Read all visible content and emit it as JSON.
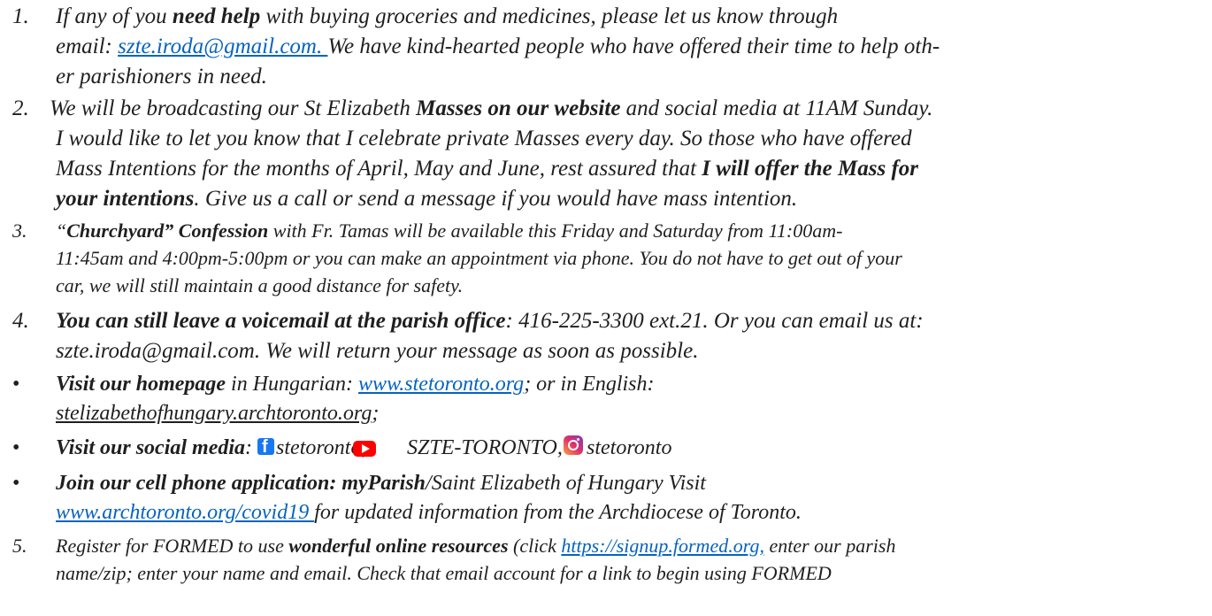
{
  "items": [
    {
      "num": "1.",
      "l1_bold": "need help",
      "l1_a": "If any of you ",
      "l1_b": " with buying groceries and  medicines, please let us know through",
      "l2_a": "email: ",
      "l2_link": "szte.iroda@gmail.com. ",
      "l2_b": "We have kind-hearted people who have offered their time to help oth-",
      "l3": "er parishioners in need."
    },
    {
      "num": "2.",
      "l1_a": " We will be broadcasting our St Elizabeth ",
      "l1_bold": "Masses on our website",
      "l1_b": " and social media at 11AM Sunday.",
      "l2": "I would like to let you know that I celebrate private Masses every day. So those who have offered",
      "l3_a": "Mass Intentions for the months of April, May and June, rest assured that ",
      "l3_bold": "I will offer the Mass for",
      "l4_bold": "your intentions",
      "l4_b": ". Give us a call or send a message if you would have mass intention."
    },
    {
      "num": "3.",
      "l1_a": "“",
      "l1_bold": "Churchyard” Confession",
      "l1_b": " with Fr. Tamas will be available this Friday and Saturday from 11:00am-",
      "l2": "11:45am and 4:00pm-5:00pm or you can make an appointment via phone. You do not have to get out of your",
      "l3": "car, we will still maintain a good distance for safety."
    },
    {
      "num": "4.",
      "l1_bold": "You can still leave a voicemail at the parish office",
      "l1_b": ": 416-225-3300 ext.21. Or you can email us at:",
      "l2": "szte.iroda@gmail.com. We will return your message as soon as possible."
    },
    {
      "bullet": "•",
      "l1_bold": "Visit our homepage",
      "l1_b": " in Hungarian: ",
      "l1_link": "www.stetoronto.org",
      "l1_c": "; or in English:",
      "l2_u": "stelizabethofhungary.archtoronto.org",
      "l2_b": ";"
    },
    {
      "bullet": "•",
      "l1_bold": "Visit our social media",
      "l1_b": ": ",
      "fb_handle": "stetoronto;",
      "yt_handle": "SZTE-TORONTO,",
      "ig_handle": "stetoronto"
    },
    {
      "bullet": "•",
      "l1_bold": "Join our cell phone application: myParish",
      "l1_b": "/Saint Elizabeth of Hungary Visit",
      "l2_link": "www.archtoronto.org/covid19 ",
      "l2_b": "for updated information from the Archdiocese of Toronto."
    },
    {
      "num": "5.",
      "l1_a": "Register for FORMED to use ",
      "l1_bold": "wonderful online resources",
      "l1_b": " (click ",
      "l1_link": "https://signup.formed.org,",
      "l1_c": " enter our parish",
      "l2": "name/zip; enter your name and email. Check that email account for a link to begin using FORMED"
    }
  ],
  "colors": {
    "link": "#0563c1",
    "text": "#1f1f1f",
    "facebook": "#1877f2",
    "youtube": "#ff0000"
  },
  "icons": [
    "facebook-icon",
    "youtube-icon",
    "instagram-icon"
  ]
}
